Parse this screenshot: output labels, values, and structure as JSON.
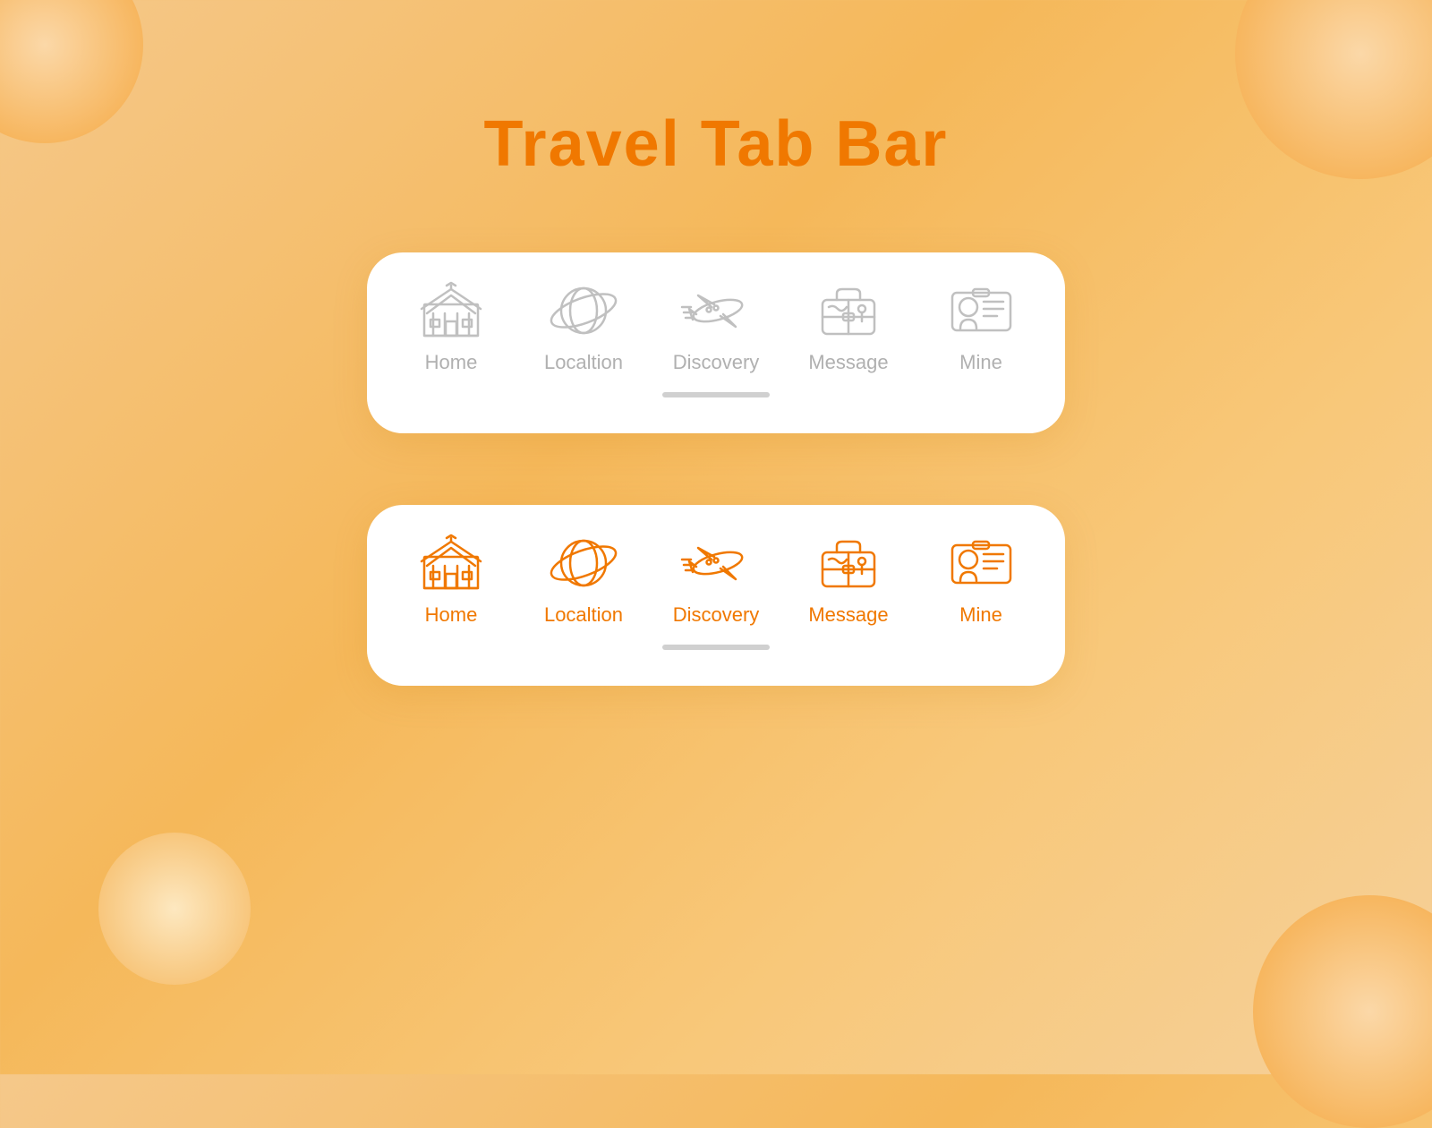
{
  "page": {
    "title": "Travel Tab Bar",
    "accent_color": "#f07800",
    "inactive_color": "#c0c0c0",
    "label_inactive": "#b0b0b0"
  },
  "tab_bars": [
    {
      "id": "inactive-bar",
      "state": "inactive",
      "items": [
        {
          "id": "home",
          "label": "Home"
        },
        {
          "id": "location",
          "label": "Localtion"
        },
        {
          "id": "discovery",
          "label": "Discovery"
        },
        {
          "id": "message",
          "label": "Message"
        },
        {
          "id": "mine",
          "label": "Mine"
        }
      ]
    },
    {
      "id": "active-bar",
      "state": "active",
      "items": [
        {
          "id": "home",
          "label": "Home"
        },
        {
          "id": "location",
          "label": "Localtion"
        },
        {
          "id": "discovery",
          "label": "Discovery"
        },
        {
          "id": "message",
          "label": "Message"
        },
        {
          "id": "mine",
          "label": "Mine"
        }
      ]
    }
  ]
}
